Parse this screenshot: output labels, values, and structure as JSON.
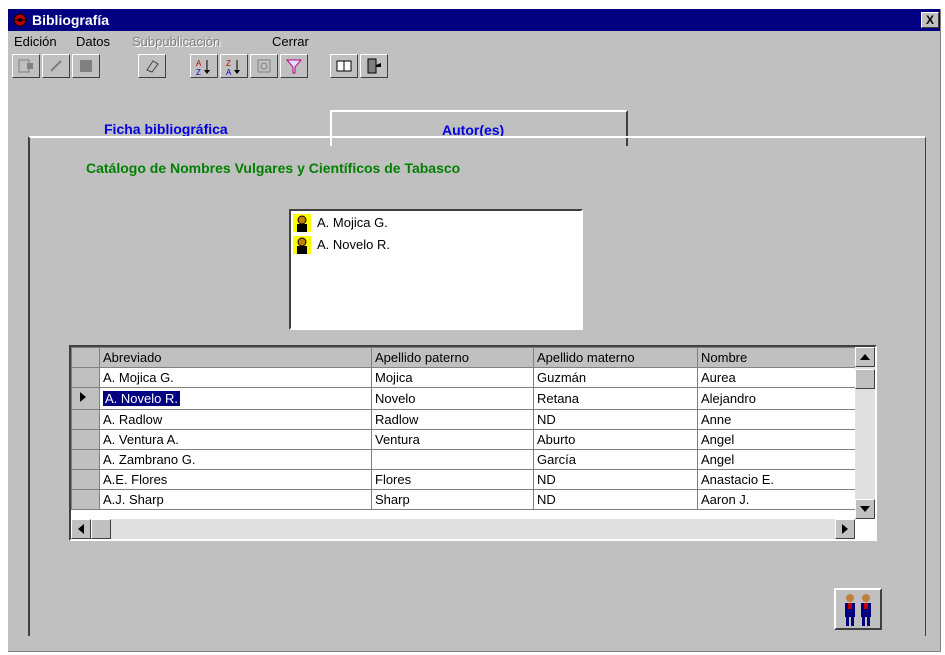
{
  "window": {
    "title": "Bibliografía",
    "close_label": "X"
  },
  "menubar": [
    {
      "label": "Edición",
      "disabled": false
    },
    {
      "label": "Datos",
      "disabled": false
    },
    {
      "label": "Subpublicación",
      "disabled": true
    },
    {
      "label": "Cerrar",
      "disabled": false
    }
  ],
  "toolbar": [
    "open-icon",
    "edit-icon",
    "stop-icon",
    "eraser-icon",
    "sort-ascending-icon",
    "sort-descending-icon",
    "refresh-icon",
    "filter-icon",
    "book-icon",
    "exit-icon"
  ],
  "tabs": {
    "ficha": "Ficha bibliográfica",
    "autores": "Autor(es)"
  },
  "catalog_title": "Catálogo de Nombres Vulgares y Científicos de Tabasco",
  "author_list": [
    "A. Mojica G.",
    "A. Novelo R."
  ],
  "grid": {
    "columns": [
      "Abreviado",
      "Apellido paterno",
      "Apellido materno",
      "Nombre"
    ],
    "rows": [
      [
        "A. Mojica G.",
        "Mojica",
        "Guzmán",
        "Aurea"
      ],
      [
        "A. Novelo R.",
        "Novelo",
        "Retana",
        "Alejandro"
      ],
      [
        "A. Radlow",
        "Radlow",
        "ND",
        "Anne"
      ],
      [
        "A. Ventura A.",
        "Ventura",
        "Aburto",
        "Angel"
      ],
      [
        "A. Zambrano G.",
        "",
        "García",
        "Angel"
      ],
      [
        "A.E. Flores",
        "Flores",
        "ND",
        "Anastacio E."
      ],
      [
        "A.J. Sharp",
        "Sharp",
        "ND",
        "Aaron J."
      ]
    ],
    "selected_row": 1
  },
  "colors": {
    "title_bg": "#000080",
    "tab_text": "#0000e0",
    "catalog_text": "#008000"
  }
}
